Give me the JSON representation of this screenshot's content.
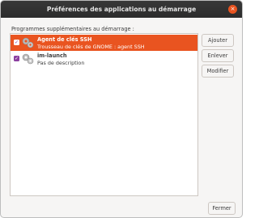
{
  "window": {
    "title": "Préférences des applications au démarrage",
    "close_glyph": "×"
  },
  "section_label": "Programmes supplémentaires au démarrage :",
  "programs": [
    {
      "name": "Agent de clés SSH",
      "description": "Trousseau de clés de GNOME : agent SSH",
      "enabled": true,
      "selected": true,
      "icon": "gears-icon"
    },
    {
      "name": "im-launch",
      "description": "Pas de description",
      "enabled": true,
      "selected": false,
      "icon": "gears-icon"
    }
  ],
  "buttons": {
    "add": "Ajouter",
    "remove": "Enlever",
    "edit": "Modifier",
    "close": "Fermer"
  },
  "colors": {
    "selection": "#e95420",
    "checkbox": "#8b3fa0",
    "titlebar": "#2c2c2c"
  }
}
